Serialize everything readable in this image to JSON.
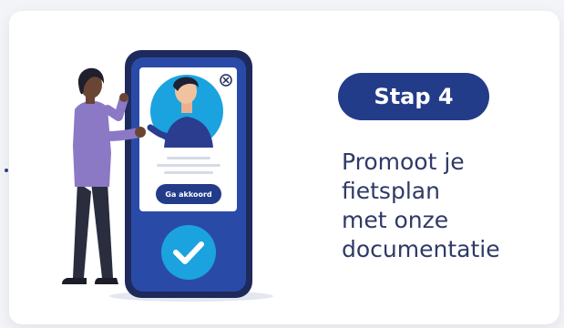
{
  "card": {
    "step_label": "Stap 4",
    "description_lines": [
      "Promoot je",
      "fietsplan",
      "met onze",
      "documentatie"
    ]
  },
  "phone": {
    "accept_button": "Ga akkoord"
  },
  "icons": {
    "close": "close-icon",
    "check": "checkmark-icon"
  },
  "colors": {
    "brand": "#233c8a",
    "accent": "#1aa3df",
    "text": "#2f3a66"
  }
}
